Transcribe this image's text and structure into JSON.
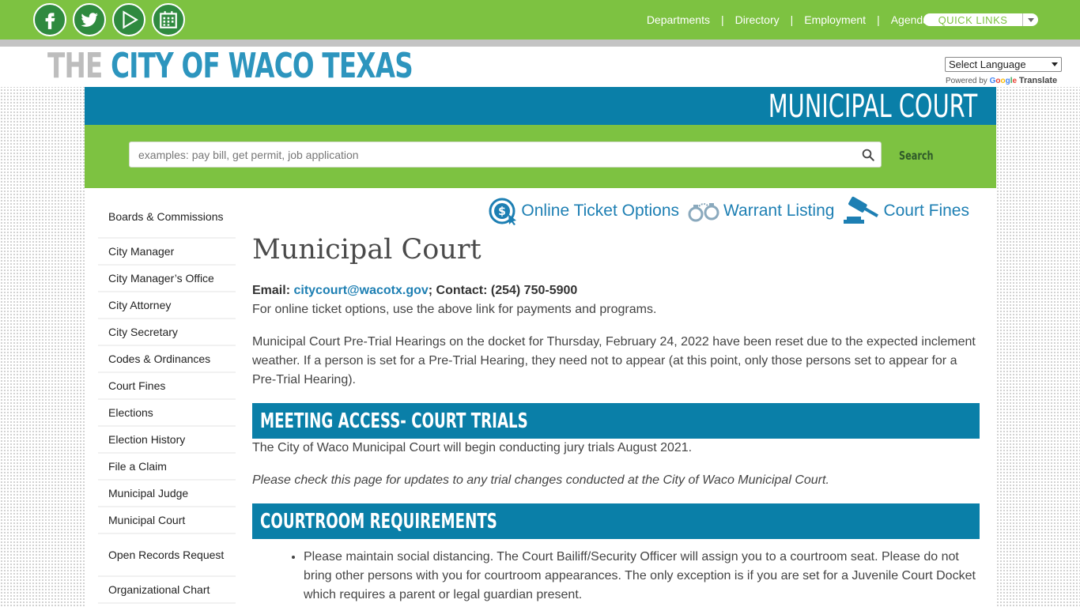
{
  "social": [
    {
      "icon": "facebook-icon"
    },
    {
      "icon": "twitter-icon"
    },
    {
      "icon": "play-icon"
    },
    {
      "icon": "calendar-icon"
    }
  ],
  "topnav": {
    "items": [
      "Departments",
      "Directory",
      "Employment",
      "Agendas"
    ],
    "quick_links": "QUICK LINKS"
  },
  "logo": {
    "the": "THE",
    "city": "CITY OF WACO TEXAS"
  },
  "translate": {
    "select": "Select Language",
    "powered_by": "Powered by",
    "google": "Google",
    "translate": "Translate"
  },
  "banner": {
    "title": "MUNICIPAL COURT"
  },
  "search": {
    "placeholder": "examples: pay bill, get permit, job application",
    "button": "Search"
  },
  "sidebar": {
    "items": [
      "Boards & Commissions",
      "City Manager",
      "City Manager’s Office",
      "City Attorney",
      "City Secretary",
      "Codes & Ordinances",
      "Court Fines",
      "Elections",
      "Election History",
      "File a Claim",
      "Municipal Judge",
      "Municipal Court",
      "Open Records Request",
      "Organizational Chart"
    ]
  },
  "quick_icons": {
    "online_ticket": "Online Ticket Options",
    "warrant": "Warrant Listing",
    "fines": "Court Fines"
  },
  "content": {
    "title": "Municipal Court",
    "email_label": "Email:",
    "email": "citycourt@wacotx.gov",
    "contact": "; Contact: (254) 750-5900",
    "online_note": "For online ticket options, use the above link for payments and programs.",
    "notice": "Municipal Court Pre-Trial Hearings on the docket for Thursday, February 24, 2022 have been reset due to the expected inclement weather.  If a person is set for a Pre-Trial Hearing, they need not to appear (at this point, only those persons set to appear for a Pre-Trial Hearing).",
    "section1_title": "Meeting Access- Court Trials",
    "section1_text": "The City of Waco Municipal Court will begin conducting jury trials August 2021.",
    "section1_italic": "Please check this page for updates to any trial changes conducted at the City of Waco Municipal Court.",
    "section2_title": "Courtroom Requirements",
    "bullets": [
      "Please maintain social distancing. The Court Bailiff/Security Officer will assign you to a courtroom seat. Please do not bring other persons with you for courtroom appearances. The only exception is if you are set for a Juvenile Court Docket which requires a parent or legal guardian present."
    ]
  },
  "colors": {
    "green": "#7dc241",
    "blue": "#0a7fa8",
    "link": "#1d7fb3"
  }
}
